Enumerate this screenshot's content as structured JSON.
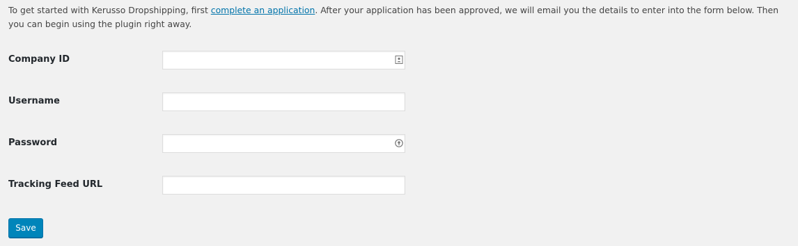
{
  "intro": {
    "text_before": "To get started with Kerusso Dropshipping, first ",
    "link_text": "complete an application",
    "text_after": ". After your application has been approved, we will email you the details to enter into the form below. Then you can begin using the plugin right away."
  },
  "form": {
    "fields": [
      {
        "label": "Company ID",
        "value": "",
        "icon": "contact-card-icon"
      },
      {
        "label": "Username",
        "value": ""
      },
      {
        "label": "Password",
        "value": "",
        "icon": "password-key-icon"
      },
      {
        "label": "Tracking Feed URL",
        "value": ""
      }
    ],
    "save_label": "Save"
  },
  "colors": {
    "background": "#f1f1f1",
    "link": "#0073aa",
    "button": "#0085ba"
  }
}
